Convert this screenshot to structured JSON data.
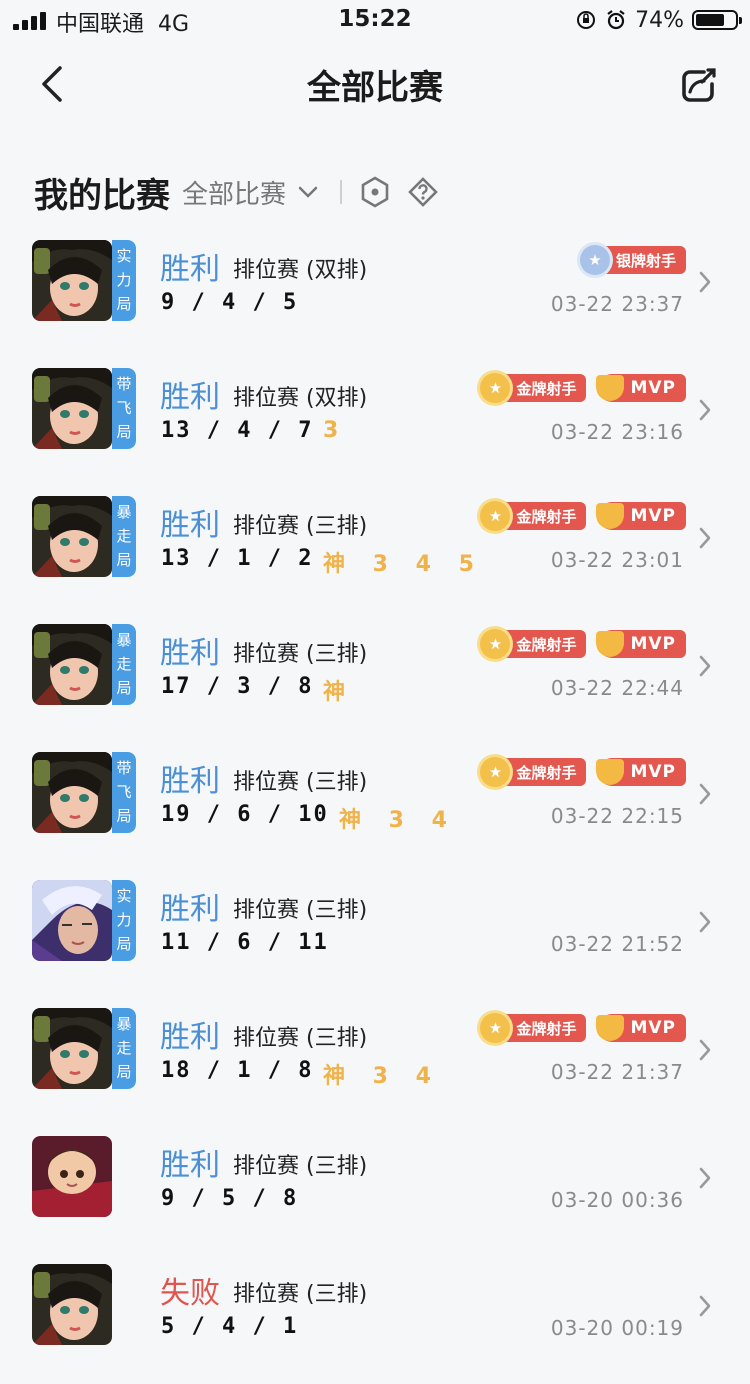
{
  "status": {
    "carrier": "中国联通",
    "network": "4G",
    "time": "15:22",
    "battery": "74%",
    "battery_level": 0.74
  },
  "nav": {
    "title": "全部比赛"
  },
  "section": {
    "title": "我的比赛",
    "filter": "全部比赛"
  },
  "matches": [
    {
      "result": "胜利",
      "win": true,
      "mode": "排位赛 (双排)",
      "kda": "9 / 4 / 5",
      "marks": "",
      "time": "03-22 23:37",
      "tag": [
        "实",
        "力",
        "局"
      ],
      "hero": "girl",
      "badges": [
        {
          "type": "silver",
          "label": "银牌射手"
        }
      ]
    },
    {
      "result": "胜利",
      "win": true,
      "mode": "排位赛 (双排)",
      "kda": "13 / 4 / 7",
      "marks": "3",
      "time": "03-22 23:16",
      "tag": [
        "带",
        "飞",
        "局"
      ],
      "hero": "girl",
      "badges": [
        {
          "type": "gold",
          "label": "金牌射手"
        },
        {
          "type": "mvp",
          "label": "MVP"
        }
      ]
    },
    {
      "result": "胜利",
      "win": true,
      "mode": "排位赛 (三排)",
      "kda": "13 / 1 / 2",
      "marks": "神 3 4 5",
      "time": "03-22 23:01",
      "tag": [
        "暴",
        "走",
        "局"
      ],
      "hero": "girl",
      "badges": [
        {
          "type": "gold",
          "label": "金牌射手"
        },
        {
          "type": "mvp",
          "label": "MVP"
        }
      ]
    },
    {
      "result": "胜利",
      "win": true,
      "mode": "排位赛 (三排)",
      "kda": "17 / 3 / 8",
      "marks": "神",
      "time": "03-22 22:44",
      "tag": [
        "暴",
        "走",
        "局"
      ],
      "hero": "girl",
      "badges": [
        {
          "type": "gold",
          "label": "金牌射手"
        },
        {
          "type": "mvp",
          "label": "MVP"
        }
      ]
    },
    {
      "result": "胜利",
      "win": true,
      "mode": "排位赛 (三排)",
      "kda": "19 / 6 / 10",
      "marks": "神 3 4",
      "time": "03-22 22:15",
      "tag": [
        "带",
        "飞",
        "局"
      ],
      "hero": "girl",
      "badges": [
        {
          "type": "gold",
          "label": "金牌射手"
        },
        {
          "type": "mvp",
          "label": "MVP"
        }
      ]
    },
    {
      "result": "胜利",
      "win": true,
      "mode": "排位赛 (三排)",
      "kda": "11 / 6 / 11",
      "marks": "",
      "time": "03-22 21:52",
      "tag": [
        "实",
        "力",
        "局"
      ],
      "hero": "silver",
      "badges": []
    },
    {
      "result": "胜利",
      "win": true,
      "mode": "排位赛 (三排)",
      "kda": "18 / 1 / 8",
      "marks": "神 3 4",
      "time": "03-22 21:37",
      "tag": [
        "暴",
        "走",
        "局"
      ],
      "hero": "girl",
      "badges": [
        {
          "type": "gold",
          "label": "金牌射手"
        },
        {
          "type": "mvp",
          "label": "MVP"
        }
      ]
    },
    {
      "result": "胜利",
      "win": true,
      "mode": "排位赛 (三排)",
      "kda": "9 / 5 / 8",
      "marks": "",
      "time": "03-20 00:36",
      "tag": [],
      "hero": "kid",
      "badges": []
    },
    {
      "result": "失败",
      "win": false,
      "mode": "排位赛 (三排)",
      "kda": "5 / 4 / 1",
      "marks": "",
      "time": "03-20 00:19",
      "tag": [],
      "hero": "girl",
      "badges": []
    }
  ],
  "colors": {
    "win": "#4b8fd6",
    "lose": "#e0554d",
    "tag": "#4a9de3",
    "mark": "#f0b24a"
  }
}
